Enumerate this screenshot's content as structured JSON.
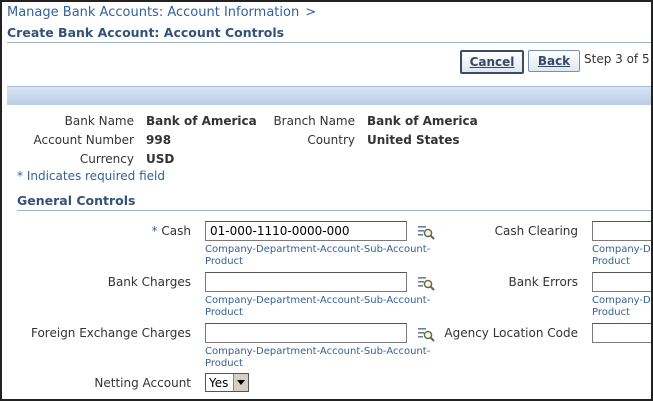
{
  "breadcrumb": {
    "link": "Manage Bank Accounts: Account Information",
    "separator": ">"
  },
  "page_title": "Create Bank Account: Account Controls",
  "buttons": {
    "cancel": "Cancel",
    "back": "Back"
  },
  "step_text": "Step 3 of 5",
  "header": {
    "bank_name_label": "Bank Name",
    "bank_name_value": "Bank of America",
    "branch_name_label": "Branch Name",
    "branch_name_value": "Bank of America",
    "account_number_label": "Account Number",
    "account_number_value": "998",
    "country_label": "Country",
    "country_value": "United States",
    "currency_label": "Currency",
    "currency_value": "USD"
  },
  "required_note": "* Indicates required field",
  "section": {
    "title": "General Controls",
    "cash_star": "*",
    "cash_label": "Cash",
    "cash_value": "01-000-1110-0000-000",
    "cash_hint_1": "Company-Department-Account-Sub-Account-",
    "cash_hint_2": "Product",
    "bank_charges_label": "Bank Charges",
    "bank_charges_value": "",
    "bank_charges_hint_1": "Company-Department-Account-Sub-Account-",
    "bank_charges_hint_2": "Product",
    "fx_charges_label": "Foreign Exchange Charges",
    "fx_charges_value": "",
    "fx_charges_hint_1": "Company-Department-Account-Sub-Account-",
    "fx_charges_hint_2": "Product",
    "netting_label": "Netting Account",
    "netting_value": "Yes",
    "cash_clearing_label": "Cash Clearing",
    "cash_clearing_hint_1": "Company-De",
    "cash_clearing_hint_2": "Product",
    "bank_errors_label": "Bank Errors",
    "bank_errors_hint_1": "Company-De",
    "bank_errors_hint_2": "Product",
    "agency_label": "Agency Location Code"
  },
  "colors": {
    "link": "#34619a",
    "heading": "#34517b",
    "band": "#b9cde6"
  },
  "icons": {
    "lov": "search-flashlight-icon",
    "dropdown": "chevron-down-icon"
  }
}
